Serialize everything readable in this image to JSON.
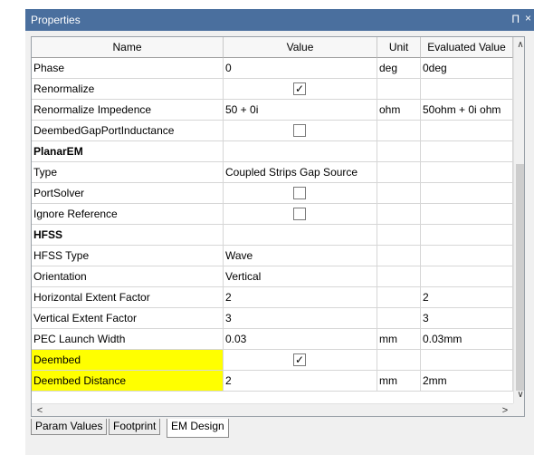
{
  "window": {
    "title": "Properties",
    "pin_glyph": "Π",
    "close_glyph": "×"
  },
  "columns": {
    "name": "Name",
    "value": "Value",
    "unit": "Unit",
    "evaluated": "Evaluated Value"
  },
  "scroll": {
    "up": "∧",
    "down": "∨",
    "left": "<",
    "right": ">"
  },
  "rows": [
    {
      "name": "Phase",
      "value": "0",
      "unit": "deg",
      "evaluated": "0deg"
    },
    {
      "name": "Renormalize",
      "checked": true
    },
    {
      "name": "Renormalize Impedence",
      "value": "50 + 0i",
      "unit": "ohm",
      "evaluated": "50ohm + 0i ohm"
    },
    {
      "name": "DeembedGapPortInductance",
      "checked": false
    },
    {
      "name": "PlanarEM",
      "section": true
    },
    {
      "name": "Type",
      "value": "Coupled Strips Gap Source"
    },
    {
      "name": "PortSolver",
      "checked": false
    },
    {
      "name": "Ignore Reference",
      "checked": false
    },
    {
      "name": "HFSS",
      "section": true
    },
    {
      "name": "HFSS Type",
      "value": "Wave"
    },
    {
      "name": "Orientation",
      "value": "Vertical"
    },
    {
      "name": "Horizontal Extent Factor",
      "value": "2",
      "evaluated": "2"
    },
    {
      "name": "Vertical Extent Factor",
      "value": "3",
      "evaluated": "3"
    },
    {
      "name": "PEC Launch Width",
      "value": "0.03",
      "unit": "mm",
      "evaluated": "0.03mm"
    },
    {
      "name": "Deembed",
      "checked": true,
      "highlight": true
    },
    {
      "name": "Deembed Distance",
      "value": "2",
      "unit": "mm",
      "evaluated": "2mm",
      "highlight": true
    }
  ],
  "checkbox": {
    "checked_glyph": "✓"
  },
  "tabs": [
    {
      "label": "Param Values",
      "active": false
    },
    {
      "label": "Footprint",
      "active": false
    },
    {
      "label": "EM Design",
      "active": true
    }
  ],
  "colors": {
    "highlight": "#ffff00",
    "titlebar": "#4a6f9e"
  }
}
